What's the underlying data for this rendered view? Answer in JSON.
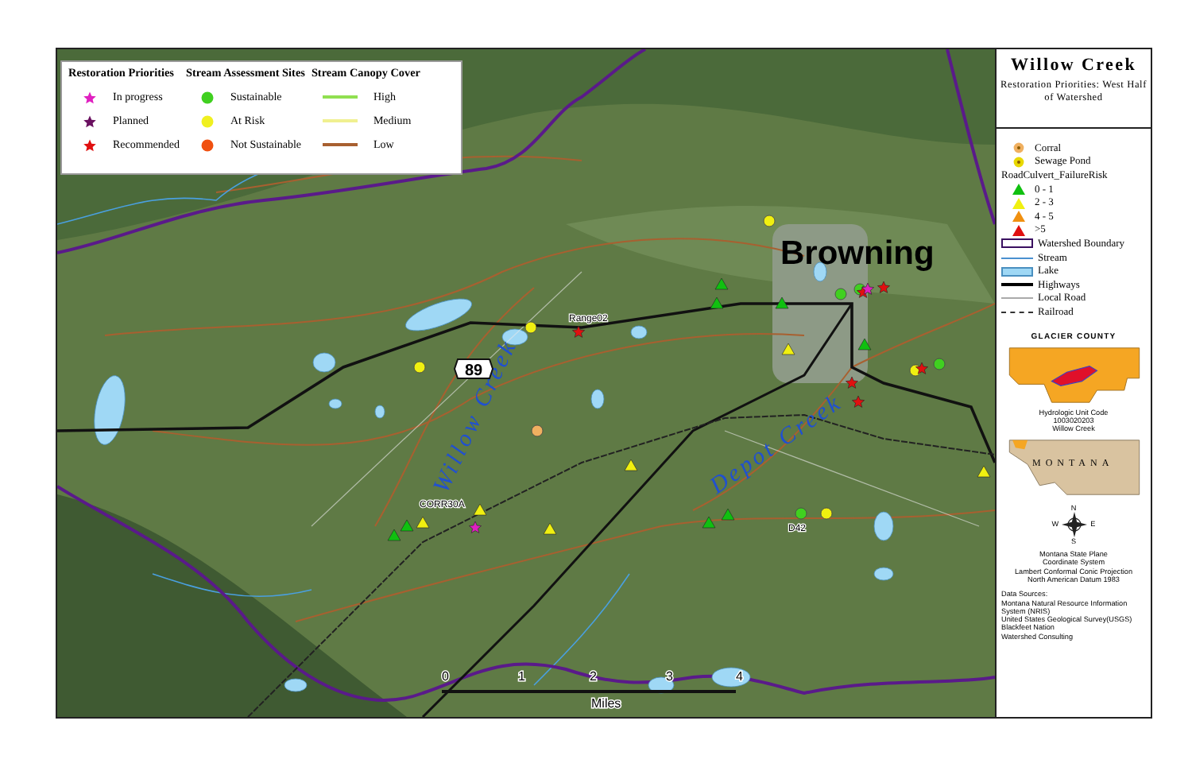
{
  "legend": {
    "columns": [
      {
        "heading": "Restoration Priorities",
        "kind": "star",
        "items": [
          {
            "label": "In progress",
            "color": "#e020c0"
          },
          {
            "label": "Planned",
            "color": "#6a1060"
          },
          {
            "label": "Recommended",
            "color": "#e01010"
          }
        ]
      },
      {
        "heading": "Stream Assessment Sites",
        "kind": "dot",
        "items": [
          {
            "label": "Sustainable",
            "color": "#40d020"
          },
          {
            "label": "At Risk",
            "color": "#f0f020"
          },
          {
            "label": "Not Sustainable",
            "color": "#f05010"
          }
        ]
      },
      {
        "heading": "Stream Canopy Cover",
        "kind": "line",
        "items": [
          {
            "label": "High",
            "color": "#90e050"
          },
          {
            "label": "Medium",
            "color": "#f0f090"
          },
          {
            "label": "Low",
            "color": "#a86030"
          }
        ]
      }
    ]
  },
  "title_panel": {
    "title": "Willow Creek",
    "subtitle": "Restoration Priorities: West Half of Watershed"
  },
  "map_legend": [
    {
      "kind": "point",
      "label": "Corral",
      "color": "#f0b060"
    },
    {
      "kind": "point",
      "label": "Sewage Pond",
      "color": "#e8d800"
    },
    {
      "kind": "heading",
      "label": "RoadCulvert_FailureRisk"
    },
    {
      "kind": "triangle",
      "label": "0 - 1",
      "color": "#10c010"
    },
    {
      "kind": "triangle",
      "label": "2 - 3",
      "color": "#f0f010"
    },
    {
      "kind": "triangle",
      "label": "4 - 5",
      "color": "#f09010"
    },
    {
      "kind": "triangle",
      "label": ">5",
      "color": "#e01010"
    },
    {
      "kind": "boundary",
      "label": "Watershed Boundary"
    },
    {
      "kind": "stream",
      "label": "Stream"
    },
    {
      "kind": "lake",
      "label": "Lake"
    },
    {
      "kind": "highway",
      "label": "Highways"
    },
    {
      "kind": "road",
      "label": "Local Road"
    },
    {
      "kind": "railroad",
      "label": "Railroad"
    }
  ],
  "locator": {
    "county_title": "GLACIER COUNTY",
    "huc_label": "Hydrologic Unit Code",
    "huc_code": "1003020203",
    "huc_name": "Willow Creek",
    "state_label": "MONTANA"
  },
  "compass": {
    "north": "N",
    "south": "S",
    "east": "E",
    "west": "W"
  },
  "projection": [
    "Montana State Plane",
    "Coordinate System",
    "Lambert Conformal Conic Projection",
    "North American Datum 1983"
  ],
  "sources": [
    "Data Sources:",
    "Montana Natural Resource Information",
    "System (NRIS)",
    "United States Geological Survey(USGS)",
    "Blackfeet Nation",
    "Watershed Consulting"
  ],
  "map": {
    "town": "Browning",
    "creeks": [
      "Willow Creek",
      "Depot Creek"
    ],
    "highway_shield": "89",
    "site_labels": [
      "Range02",
      "CORR30A",
      "D42"
    ],
    "scale": {
      "ticks": [
        "0",
        "1",
        "2",
        "3",
        "4"
      ],
      "unit": "Miles"
    }
  }
}
